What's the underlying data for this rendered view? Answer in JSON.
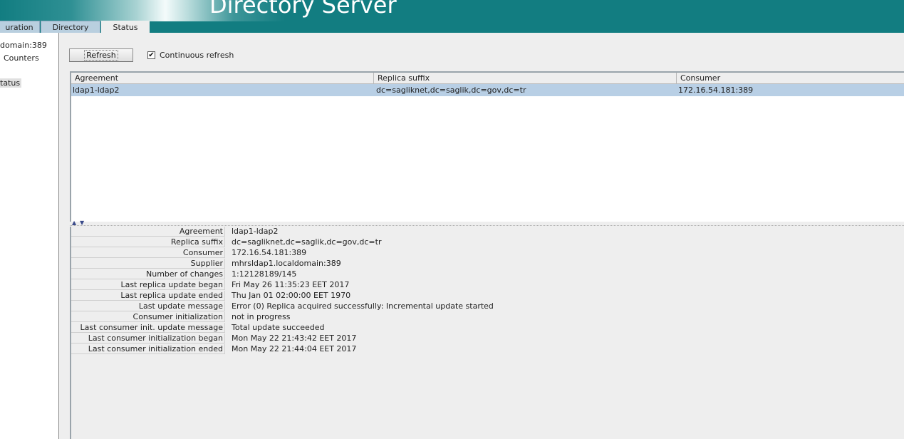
{
  "header": {
    "title": "Directory Server"
  },
  "tabs": [
    {
      "label": "uration"
    },
    {
      "label": "Directory"
    },
    {
      "label": "Status"
    }
  ],
  "tree": {
    "items": [
      {
        "label": "domain:389"
      },
      {
        "label": "Counters"
      },
      {
        "label": "tatus"
      }
    ]
  },
  "toolbar": {
    "refresh_label": "Refresh",
    "continuous_label": "Continuous refresh",
    "continuous_checked": true,
    "check_glyph": "✔"
  },
  "table": {
    "columns": [
      "Agreement",
      "Replica suffix",
      "Consumer"
    ],
    "rows": [
      [
        "ldap1-ldap2",
        "dc=sagliknet,dc=saglik,dc=gov,dc=tr",
        "172.16.54.181:389"
      ]
    ]
  },
  "details": [
    {
      "label": "Agreement",
      "value": "ldap1-ldap2"
    },
    {
      "label": "Replica suffix",
      "value": "dc=sagliknet,dc=saglik,dc=gov,dc=tr"
    },
    {
      "label": "Consumer",
      "value": "172.16.54.181:389"
    },
    {
      "label": "Supplier",
      "value": "mhrsldap1.localdomain:389"
    },
    {
      "label": "Number of changes",
      "value": "1:12128189/145"
    },
    {
      "label": "Last replica update began",
      "value": "Fri May 26 11:35:23 EET 2017"
    },
    {
      "label": "Last replica update ended",
      "value": "Thu Jan 01 02:00:00 EET 1970"
    },
    {
      "label": "Last update message",
      "value": "Error (0) Replica acquired successfully: Incremental update started"
    },
    {
      "label": "Consumer initialization",
      "value": "not in progress"
    },
    {
      "label": "Last consumer init. update message",
      "value": "Total update succeeded"
    },
    {
      "label": "Last consumer initialization began",
      "value": "Mon May 22 21:43:42 EET 2017"
    },
    {
      "label": "Last consumer initialization ended",
      "value": "Mon May 22 21:44:04 EET 2017"
    }
  ],
  "colors": {
    "header_bg": "#127d81",
    "selection": "#b8cfe5",
    "tab_bg": "#b9cfdf"
  }
}
